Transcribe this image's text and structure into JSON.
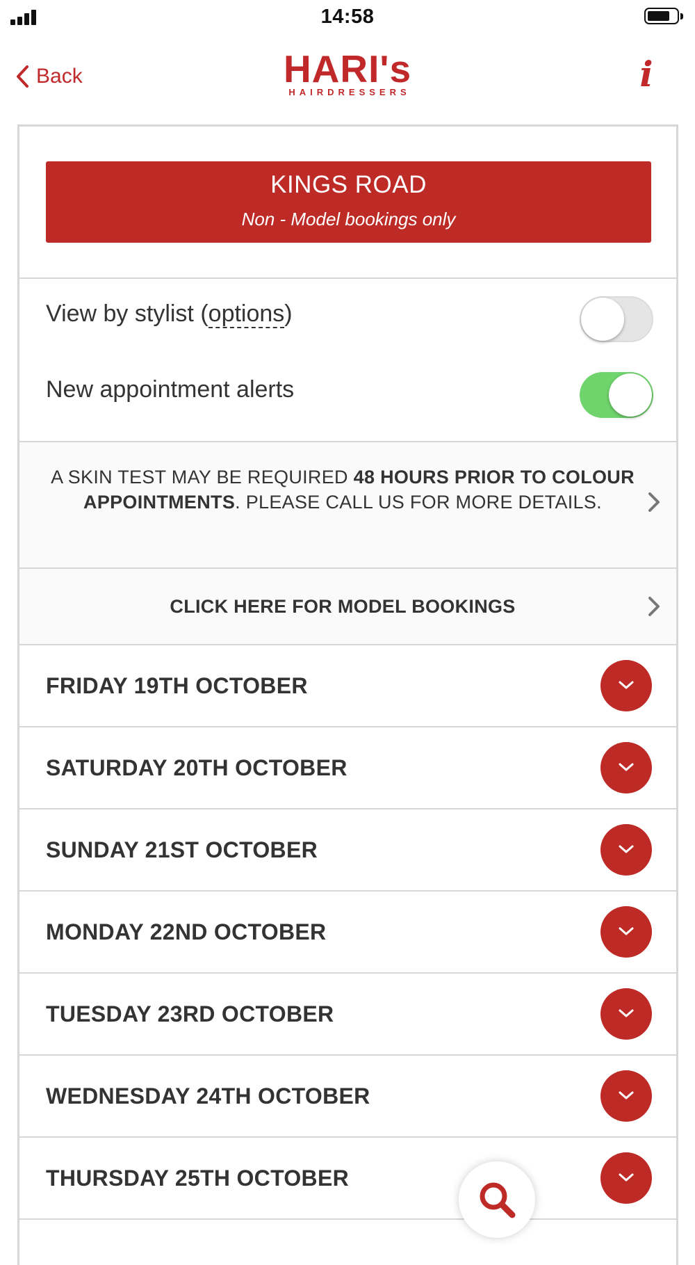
{
  "status_bar": {
    "time": "14:58"
  },
  "nav": {
    "back_label": "Back",
    "logo_main": "HARI's",
    "logo_sub": "HAIRDRESSERS",
    "info_label": "i"
  },
  "location": {
    "title": "KINGS ROAD",
    "subtitle": "Non - Model bookings only"
  },
  "settings": {
    "view_by_stylist_prefix": "View by stylist (",
    "view_by_stylist_link": "options",
    "view_by_stylist_suffix": ")",
    "view_by_stylist_enabled": false,
    "alerts_label": "New appointment alerts",
    "alerts_enabled": true
  },
  "notice": {
    "part1": "A SKIN TEST MAY BE REQUIRED ",
    "bold": "48 HOURS PRIOR TO COLOUR APPOINTMENTS",
    "part2": ". PLEASE CALL US FOR MORE DETAILS."
  },
  "model_bookings_label": "CLICK HERE FOR MODEL BOOKINGS",
  "days": [
    {
      "label": "FRIDAY 19TH OCTOBER"
    },
    {
      "label": "SATURDAY 20TH OCTOBER"
    },
    {
      "label": "SUNDAY 21ST OCTOBER"
    },
    {
      "label": "MONDAY 22ND OCTOBER"
    },
    {
      "label": "TUESDAY 23RD OCTOBER"
    },
    {
      "label": "WEDNESDAY 24TH OCTOBER"
    },
    {
      "label": "THURSDAY 25TH OCTOBER"
    }
  ],
  "colors": {
    "brand_red": "#be2b27",
    "toggle_on": "#6fd46b"
  },
  "icons": [
    "signal-icon",
    "battery-icon",
    "back-chevron-icon",
    "info-icon",
    "chevron-right-icon",
    "chevron-down-icon",
    "search-icon"
  ]
}
